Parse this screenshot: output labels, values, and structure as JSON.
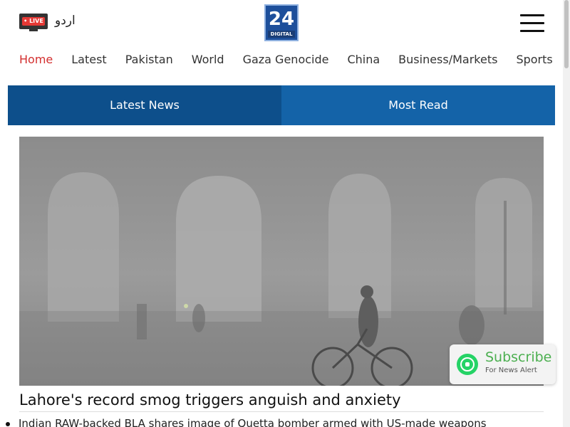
{
  "header": {
    "live_badge": "• LIVE",
    "urdu_link": "اردو",
    "logo_number": "24",
    "logo_text": "DIGITAL"
  },
  "nav": {
    "items": [
      "Home",
      "Latest",
      "Pakistan",
      "World",
      "Gaza Genocide",
      "China",
      "Business/Markets",
      "Sports"
    ],
    "active_index": 0
  },
  "tabs": {
    "latest": "Latest News",
    "most_read": "Most Read"
  },
  "hero": {
    "headline": "Lahore's record smog triggers anguish and anxiety"
  },
  "list": {
    "item1": "Indian RAW-backed BLA shares image of Quetta bomber armed with US-made weapons"
  },
  "subscribe": {
    "title": "Subscribe",
    "subtitle": "For News Alert"
  },
  "colors": {
    "accent_red": "#d32f2f",
    "tab_active": "#0d4f8b",
    "tab_inactive": "#1463a8",
    "whatsapp_green": "#25d366"
  }
}
